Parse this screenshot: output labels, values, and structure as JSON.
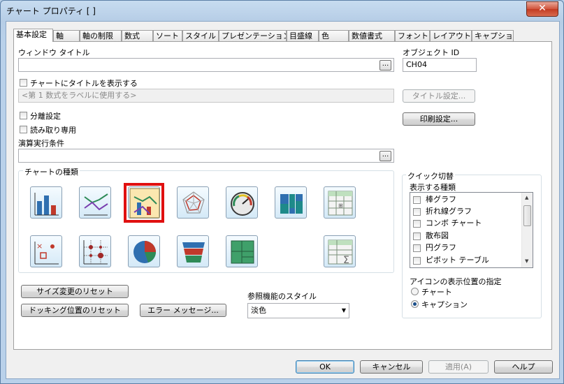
{
  "window": {
    "title": "チャート プロパティ [ ]",
    "close_glyph": "✕"
  },
  "tabs": [
    {
      "label": "基本設定"
    },
    {
      "label": "軸"
    },
    {
      "label": "軸の制限"
    },
    {
      "label": "数式"
    },
    {
      "label": "ソート"
    },
    {
      "label": "スタイル"
    },
    {
      "label": "プレゼンテーション"
    },
    {
      "label": "目盛線"
    },
    {
      "label": "色"
    },
    {
      "label": "数値書式"
    },
    {
      "label": "フォント"
    },
    {
      "label": "レイアウト"
    },
    {
      "label": "キャプション"
    }
  ],
  "general": {
    "window_title_label": "ウィンドウ タイトル",
    "window_title_value": "",
    "object_id_label": "オブジェクト ID",
    "object_id_value": "CH04",
    "dots_label": "...",
    "show_title_label": "チャートにタイトルを表示する",
    "title_placeholder": "<第 1 数式をラベルに使用する>",
    "title_settings_button": "タイトル設定...",
    "detach_label": "分離設定",
    "readonly_label": "読み取り専用",
    "print_settings_button": "印刷設定...",
    "calc_condition_label": "演算実行条件",
    "calc_condition_value": ""
  },
  "chart_types": {
    "group_label": "チャートの種類",
    "icons": [
      {
        "name": "bar-chart-icon"
      },
      {
        "name": "line-chart-icon"
      },
      {
        "name": "combo-chart-icon"
      },
      {
        "name": "radar-chart-icon"
      },
      {
        "name": "gauge-chart-icon"
      },
      {
        "name": "mekko-chart-icon"
      },
      {
        "name": "pivot-table-icon"
      },
      {
        "name": "scatter-chart-icon"
      },
      {
        "name": "grid-chart-icon"
      },
      {
        "name": "pie-chart-icon"
      },
      {
        "name": "funnel-chart-icon"
      },
      {
        "name": "block-chart-icon"
      },
      {
        "name": "straight-table-icon"
      }
    ],
    "selected": "combo-chart-icon"
  },
  "quick_switch": {
    "group_label": "クイック切替",
    "types_label": "表示する種類",
    "items": [
      {
        "label": "棒グラフ"
      },
      {
        "label": "折れ線グラフ"
      },
      {
        "label": "コンボ チャート"
      },
      {
        "label": "散布図"
      },
      {
        "label": "円グラフ"
      },
      {
        "label": "ピボット テーブル"
      }
    ],
    "icon_position_label": "アイコンの表示位置の指定",
    "radio_chart": "チャート",
    "radio_caption": "キャプション",
    "radio_selected": "caption"
  },
  "bottom_buttons": {
    "reset_size": "サイズ変更のリセット",
    "reset_docking": "ドッキング位置のリセット",
    "error_messages": "エラー メッセージ...",
    "ref_style_label": "参照機能のスタイル",
    "ref_style_value": "淡色"
  },
  "footer": {
    "ok": "OK",
    "cancel": "キャンセル",
    "apply": "適用(A)",
    "help": "ヘルプ"
  },
  "colors": {
    "selection_frame": "#e01010",
    "window_frame": "#b9d1ea"
  }
}
